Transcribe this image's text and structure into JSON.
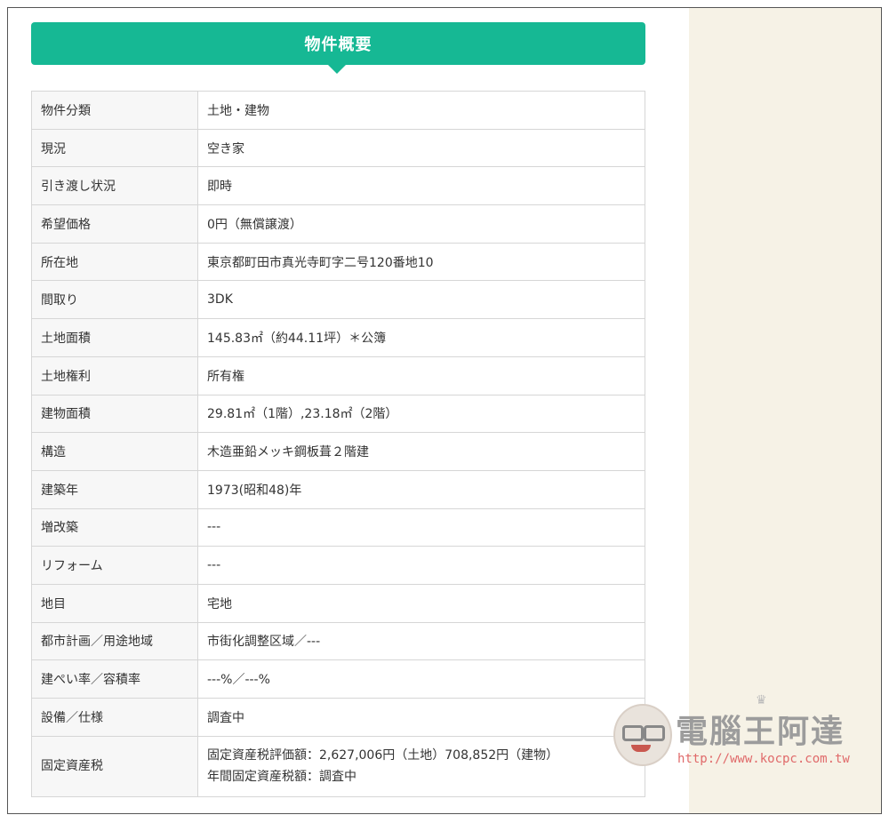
{
  "heading": "物件概要",
  "rows": [
    {
      "label": "物件分類",
      "value": "土地・建物"
    },
    {
      "label": "現況",
      "value": "空き家"
    },
    {
      "label": "引き渡し状況",
      "value": "即時"
    },
    {
      "label": "希望価格",
      "value": "0円（無償譲渡）"
    },
    {
      "label": "所在地",
      "value": "東京都町田市真光寺町字二号120番地10"
    },
    {
      "label": "間取り",
      "value": "3DK"
    },
    {
      "label": "土地面積",
      "value": "145.83㎡（約44.11坪）＊公簿"
    },
    {
      "label": "土地権利",
      "value": "所有権"
    },
    {
      "label": "建物面積",
      "value": "29.81㎡（1階）,23.18㎡（2階）"
    },
    {
      "label": "構造",
      "value": "木造亜鉛メッキ鋼板葺２階建"
    },
    {
      "label": "建築年",
      "value": "1973(昭和48)年"
    },
    {
      "label": "増改築",
      "value": "---"
    },
    {
      "label": "リフォーム",
      "value": "---"
    },
    {
      "label": "地目",
      "value": "宅地"
    },
    {
      "label": "都市計画／用途地域",
      "value": "市街化調整区域／---"
    },
    {
      "label": "建ぺい率／容積率",
      "value": "---%／---%"
    },
    {
      "label": "設備／仕様",
      "value": "調査中"
    },
    {
      "label": "固定資産税",
      "value": "固定資産税評価額：2,627,006円（土地）708,852円（建物）",
      "value2": "年間固定資産税額：調査中"
    }
  ],
  "watermark": {
    "title": "電腦王阿達",
    "url": "http://www.kocpc.com.tw"
  },
  "colors": {
    "accent": "#16b894",
    "sidebar": "#f6f2e6"
  }
}
